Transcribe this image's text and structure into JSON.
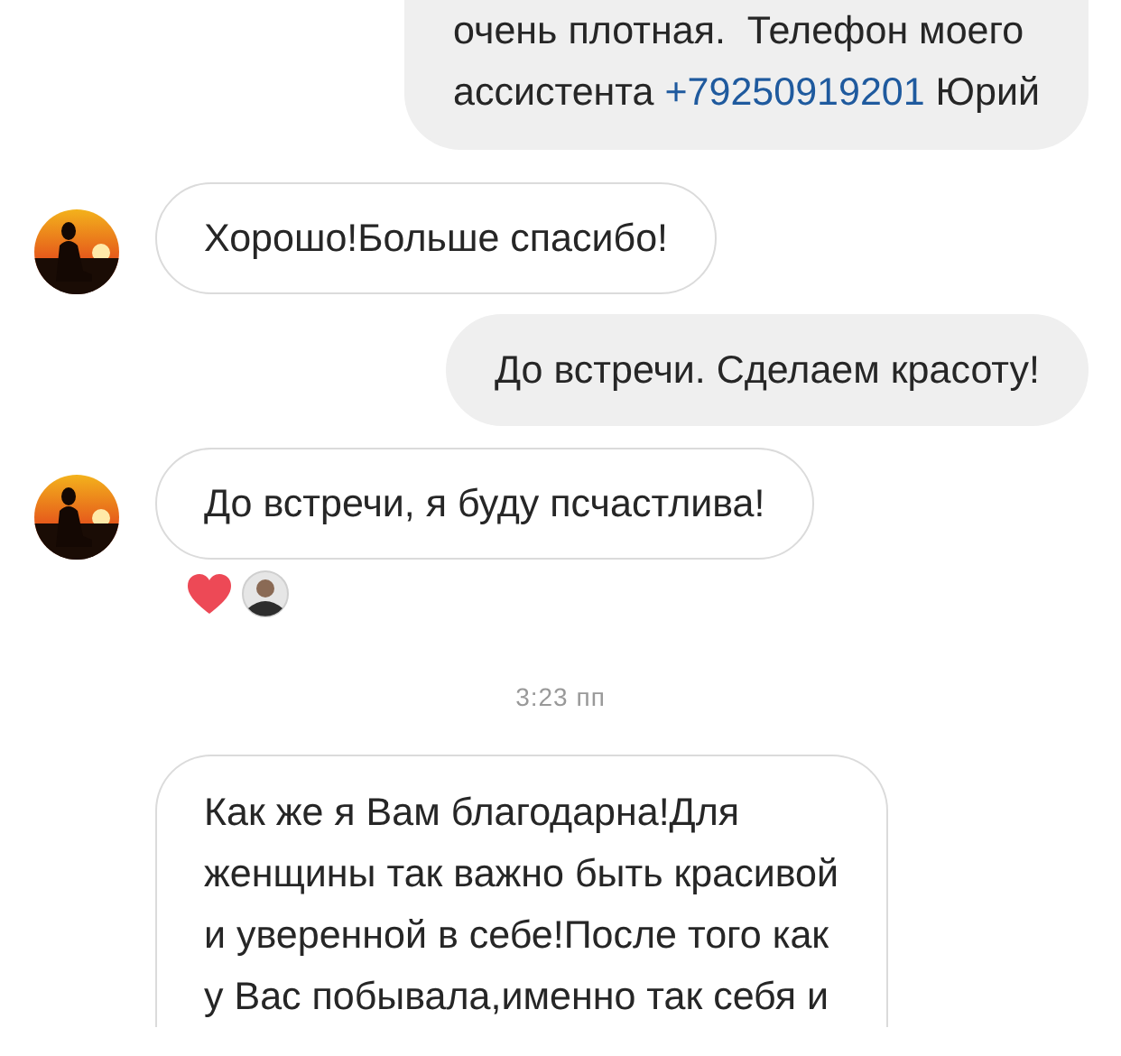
{
  "messages": [
    {
      "kind": "outgoing",
      "cut_top": true,
      "parts": [
        {
          "kind": "text",
          "text": "очень плотная.  Телефон моего\nассистента "
        },
        {
          "kind": "link",
          "text": "+79250919201"
        },
        {
          "kind": "text",
          "text": " Юрий"
        }
      ]
    },
    {
      "kind": "incoming",
      "avatar": {
        "kind": "picture"
      },
      "parts": [
        {
          "kind": "text",
          "text": "Хорошо!Больше спасибо!"
        }
      ]
    },
    {
      "kind": "outgoing",
      "parts": [
        {
          "kind": "text",
          "text": "До встречи. Сделаем красоту!"
        }
      ]
    },
    {
      "kind": "incoming",
      "avatar": {
        "kind": "picture"
      },
      "parts": [
        {
          "kind": "text",
          "text": "До встречи, я буду псчастлива!"
        }
      ],
      "reactions": [
        {
          "kind": "heart"
        },
        {
          "kind": "user"
        }
      ]
    },
    {
      "kind": "time",
      "text": "3:23 пп"
    },
    {
      "kind": "incoming",
      "cut_bottom": true,
      "parts": [
        {
          "kind": "text",
          "text": "Как же я Вам благодарна!Для\nженщины так важно быть красивой\nи уверенной в себе!После того как\nу Вас побывала,именно так себя и"
        }
      ]
    }
  ]
}
